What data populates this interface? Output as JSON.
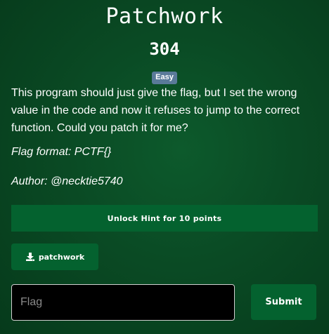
{
  "challenge": {
    "title": "Patchwork",
    "points": "304",
    "difficulty": "Easy",
    "description": "This program should just give the flag, but I set the wrong value in the code and now it refuses to jump to the correct function. Could you patch it for me?",
    "flag_format": "Flag format: PCTF{}",
    "author": "Author: @necktie5740"
  },
  "actions": {
    "hint_label": "Unlock Hint for 10 points",
    "download_label": "patchwork",
    "download_icon": "download-icon"
  },
  "form": {
    "flag_placeholder": "Flag",
    "flag_value": "",
    "submit_label": "Submit"
  },
  "colors": {
    "button_green": "#04622f",
    "badge_blue": "#5a7a99",
    "background": "#0a4a24"
  }
}
